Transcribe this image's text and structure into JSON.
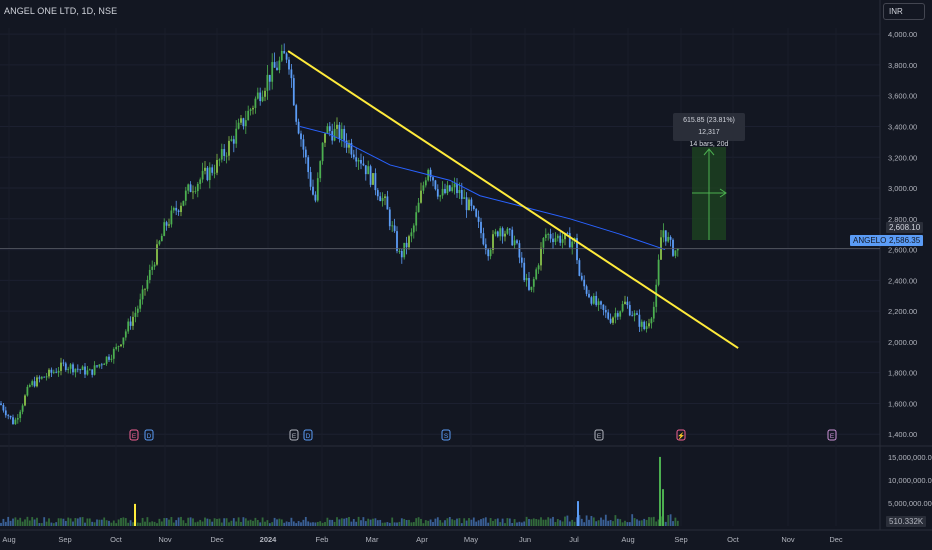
{
  "header": {
    "symbol_title": "ANGEL ONE LTD, 1D, NSE",
    "currency": "INR"
  },
  "colors": {
    "background": "#131722",
    "up": "#26a69a",
    "up_bright": "#4caf50",
    "down": "#5b9cf6",
    "trendline": "#ffeb3b",
    "moving_average": "#2962ff",
    "measure_fill": "#1e4620",
    "measure_arrow": "#4caf50"
  },
  "price_labels": {
    "last_price": "2,608.10",
    "symbol_tag": "ANGELONE",
    "symbol_price": "2,586.35",
    "volume_value": "510.332K"
  },
  "measure_tool": {
    "line1": "615.85 (23.81%) 12,317",
    "line2": "14 bars, 20d"
  },
  "event_markers": [
    "E",
    "D",
    "E",
    "D",
    "S",
    "E",
    "⚡",
    "E"
  ],
  "chart_data": {
    "type": "candlestick",
    "title": "",
    "x_labels": [
      "Aug",
      "Sep",
      "Oct",
      "Nov",
      "Dec",
      "2024",
      "Feb",
      "Mar",
      "Apr",
      "May",
      "Jun",
      "Jul",
      "Aug",
      "Sep",
      "Oct",
      "Nov",
      "Dec"
    ],
    "price_axis": {
      "ticks": [
        "4,000.00",
        "3,800.00",
        "3,600.00",
        "3,400.00",
        "3,200.00",
        "3,000.00",
        "2,800.00",
        "2,600.00",
        "2,400.00",
        "2,200.00",
        "2,000.00",
        "1,800.00",
        "1,600.00",
        "1,400.00"
      ],
      "range": [
        1330,
        4040
      ]
    },
    "volume_axis": {
      "ticks": [
        "15,000,000.00",
        "10,000,000.00",
        "5,000,000.00"
      ],
      "range": [
        0,
        16500000
      ]
    },
    "price_path": {
      "months": [
        "2023-08",
        "2023-09",
        "2023-10",
        "2023-11",
        "2023-12",
        "2024-01",
        "2024-02",
        "2024-03",
        "2024-04",
        "2024-05",
        "2024-06",
        "2024-07",
        "2024-08",
        "2024-09"
      ],
      "month_start_close": [
        1620,
        1790,
        1850,
        2250,
        3000,
        3720,
        3250,
        2850,
        3000,
        2750,
        2500,
        2650,
        2250,
        2600
      ],
      "peak": 3900,
      "low": 1460,
      "last_close": 2586.35
    },
    "trendline": {
      "start": [
        0.292,
        3890
      ],
      "end": [
        0.792,
        1960
      ]
    },
    "moving_average": [
      3400,
      3350,
      3250,
      3150,
      3100,
      3050,
      2950,
      2900,
      2850,
      2800,
      2700,
      2600
    ],
    "volume_spikes": [
      {
        "position": "2023-10",
        "value": 4800000
      },
      {
        "position": "2024-07",
        "value": 5400000
      },
      {
        "position": "2024-08-end",
        "value": 15000000
      },
      {
        "position": "2024-08-end-2",
        "value": 8000000
      }
    ]
  }
}
